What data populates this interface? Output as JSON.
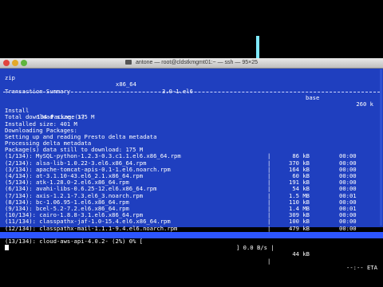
{
  "window": {
    "title": "antone — root@cldstkmgmt01:~ — ssh — 95×25"
  },
  "header_line": {
    "name": "zip",
    "arch": "x86_64",
    "version": "3.0-1.el6",
    "repo": "base",
    "size": "260 k"
  },
  "summary": {
    "title": "Transaction Summary",
    "install_label": "Install",
    "install_count": "134 Package(s)",
    "lines": [
      "Total download size: 175 M",
      "Installed size: 401 M",
      "Downloading Packages:",
      "Setting up and reading Presto delta metadata",
      "Processing delta metadata",
      "Package(s) data still to download: 175 M"
    ]
  },
  "downloads": [
    {
      "name": "(1/134): MySQL-python-1.2.3-0.3.c1.1.el6.x86_64.rpm",
      "size": "86 kB",
      "time": "00:00"
    },
    {
      "name": "(2/134): alsa-lib-1.0.22-3.el6.x86_64.rpm",
      "size": "370 kB",
      "time": "00:00"
    },
    {
      "name": "(3/134): apache-tomcat-apis-0.1-1.el6.noarch.rpm",
      "size": "164 kB",
      "time": "00:00"
    },
    {
      "name": "(4/134): at-3.1.10-43.el6_2.1.x86_64.rpm",
      "size": "60 kB",
      "time": "00:00"
    },
    {
      "name": "(5/134): atk-1.28.0-2.el6.x86_64.rpm",
      "size": "191 kB",
      "time": "00:00"
    },
    {
      "name": "(6/134): avahi-libs-0.6.25-12.el6.x86_64.rpm",
      "size": "54 kB",
      "time": "00:00"
    },
    {
      "name": "(7/134): axis-1.2.1-7.3.el6_3.noarch.rpm",
      "size": "1.5 MB",
      "time": "00:01"
    },
    {
      "name": "(8/134): bc-1.06.95-1.el6.x86_64.rpm",
      "size": "110 kB",
      "time": "00:00"
    },
    {
      "name": "(9/134): bcel-5.2-7.2.el6.x86_64.rpm",
      "size": "1.4 MB",
      "time": "00:01"
    },
    {
      "name": "(10/134): cairo-1.8.8-3.1.el6.x86_64.rpm",
      "size": "309 kB",
      "time": "00:00"
    },
    {
      "name": "(11/134): classpathx-jaf-1.0-15.4.el6.x86_64.rpm",
      "size": "100 kB",
      "time": "00:00"
    },
    {
      "name": "(12/134): classpathx-mail-1.1.1-9.4.el6.noarch.rpm",
      "size": "479 kB",
      "time": "00:00"
    }
  ],
  "current_download": {
    "name": "(13/134): cloud-aws-api-4.0.2- (2%) 0% [",
    "rate": "] 0.0 B/s |",
    "size": "44 kB",
    "eta": "--:-- ETA"
  }
}
